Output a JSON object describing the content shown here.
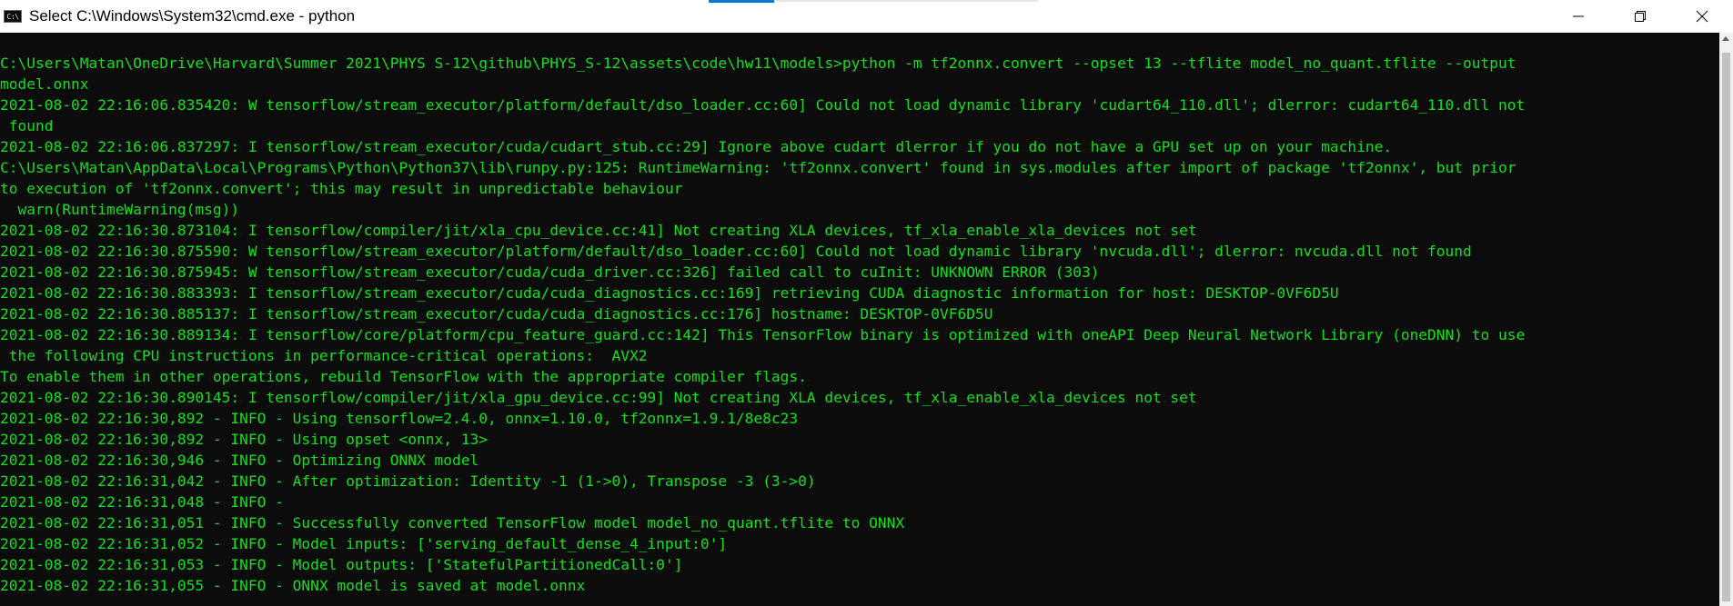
{
  "window": {
    "title": "Select C:\\Windows\\System32\\cmd.exe - python",
    "icon_text": "C:\\",
    "controls": {
      "minimize_icon": "minimize-icon",
      "maximize_icon": "restore-icon",
      "close_icon": "close-icon"
    }
  },
  "terminal": {
    "text_color": "#13e01a",
    "background": "#0c0c0c",
    "lines": [
      "C:\\Users\\Matan\\OneDrive\\Harvard\\Summer 2021\\PHYS S-12\\github\\PHYS_S-12\\assets\\code\\hw11\\models>python -m tf2onnx.convert --opset 13 --tflite model_no_quant.tflite --output",
      "model.onnx",
      "2021-08-02 22:16:06.835420: W tensorflow/stream_executor/platform/default/dso_loader.cc:60] Could not load dynamic library 'cudart64_110.dll'; dlerror: cudart64_110.dll not",
      " found",
      "2021-08-02 22:16:06.837297: I tensorflow/stream_executor/cuda/cudart_stub.cc:29] Ignore above cudart dlerror if you do not have a GPU set up on your machine.",
      "C:\\Users\\Matan\\AppData\\Local\\Programs\\Python\\Python37\\lib\\runpy.py:125: RuntimeWarning: 'tf2onnx.convert' found in sys.modules after import of package 'tf2onnx', but prior",
      "to execution of 'tf2onnx.convert'; this may result in unpredictable behaviour",
      "  warn(RuntimeWarning(msg))",
      "2021-08-02 22:16:30.873104: I tensorflow/compiler/jit/xla_cpu_device.cc:41] Not creating XLA devices, tf_xla_enable_xla_devices not set",
      "2021-08-02 22:16:30.875590: W tensorflow/stream_executor/platform/default/dso_loader.cc:60] Could not load dynamic library 'nvcuda.dll'; dlerror: nvcuda.dll not found",
      "2021-08-02 22:16:30.875945: W tensorflow/stream_executor/cuda/cuda_driver.cc:326] failed call to cuInit: UNKNOWN ERROR (303)",
      "2021-08-02 22:16:30.883393: I tensorflow/stream_executor/cuda/cuda_diagnostics.cc:169] retrieving CUDA diagnostic information for host: DESKTOP-0VF6D5U",
      "2021-08-02 22:16:30.885137: I tensorflow/stream_executor/cuda/cuda_diagnostics.cc:176] hostname: DESKTOP-0VF6D5U",
      "2021-08-02 22:16:30.889134: I tensorflow/core/platform/cpu_feature_guard.cc:142] This TensorFlow binary is optimized with oneAPI Deep Neural Network Library (oneDNN) to use",
      " the following CPU instructions in performance-critical operations:  AVX2",
      "To enable them in other operations, rebuild TensorFlow with the appropriate compiler flags.",
      "2021-08-02 22:16:30.890145: I tensorflow/compiler/jit/xla_gpu_device.cc:99] Not creating XLA devices, tf_xla_enable_xla_devices not set",
      "2021-08-02 22:16:30,892 - INFO - Using tensorflow=2.4.0, onnx=1.10.0, tf2onnx=1.9.1/8e8c23",
      "2021-08-02 22:16:30,892 - INFO - Using opset <onnx, 13>",
      "2021-08-02 22:16:30,946 - INFO - Optimizing ONNX model",
      "2021-08-02 22:16:31,042 - INFO - After optimization: Identity -1 (1->0), Transpose -3 (3->0)",
      "2021-08-02 22:16:31,048 - INFO -",
      "2021-08-02 22:16:31,051 - INFO - Successfully converted TensorFlow model model_no_quant.tflite to ONNX",
      "2021-08-02 22:16:31,052 - INFO - Model inputs: ['serving_default_dense_4_input:0']",
      "2021-08-02 22:16:31,053 - INFO - Model outputs: ['StatefulPartitionedCall:0']",
      "2021-08-02 22:16:31,055 - INFO - ONNX model is saved at model.onnx"
    ]
  }
}
